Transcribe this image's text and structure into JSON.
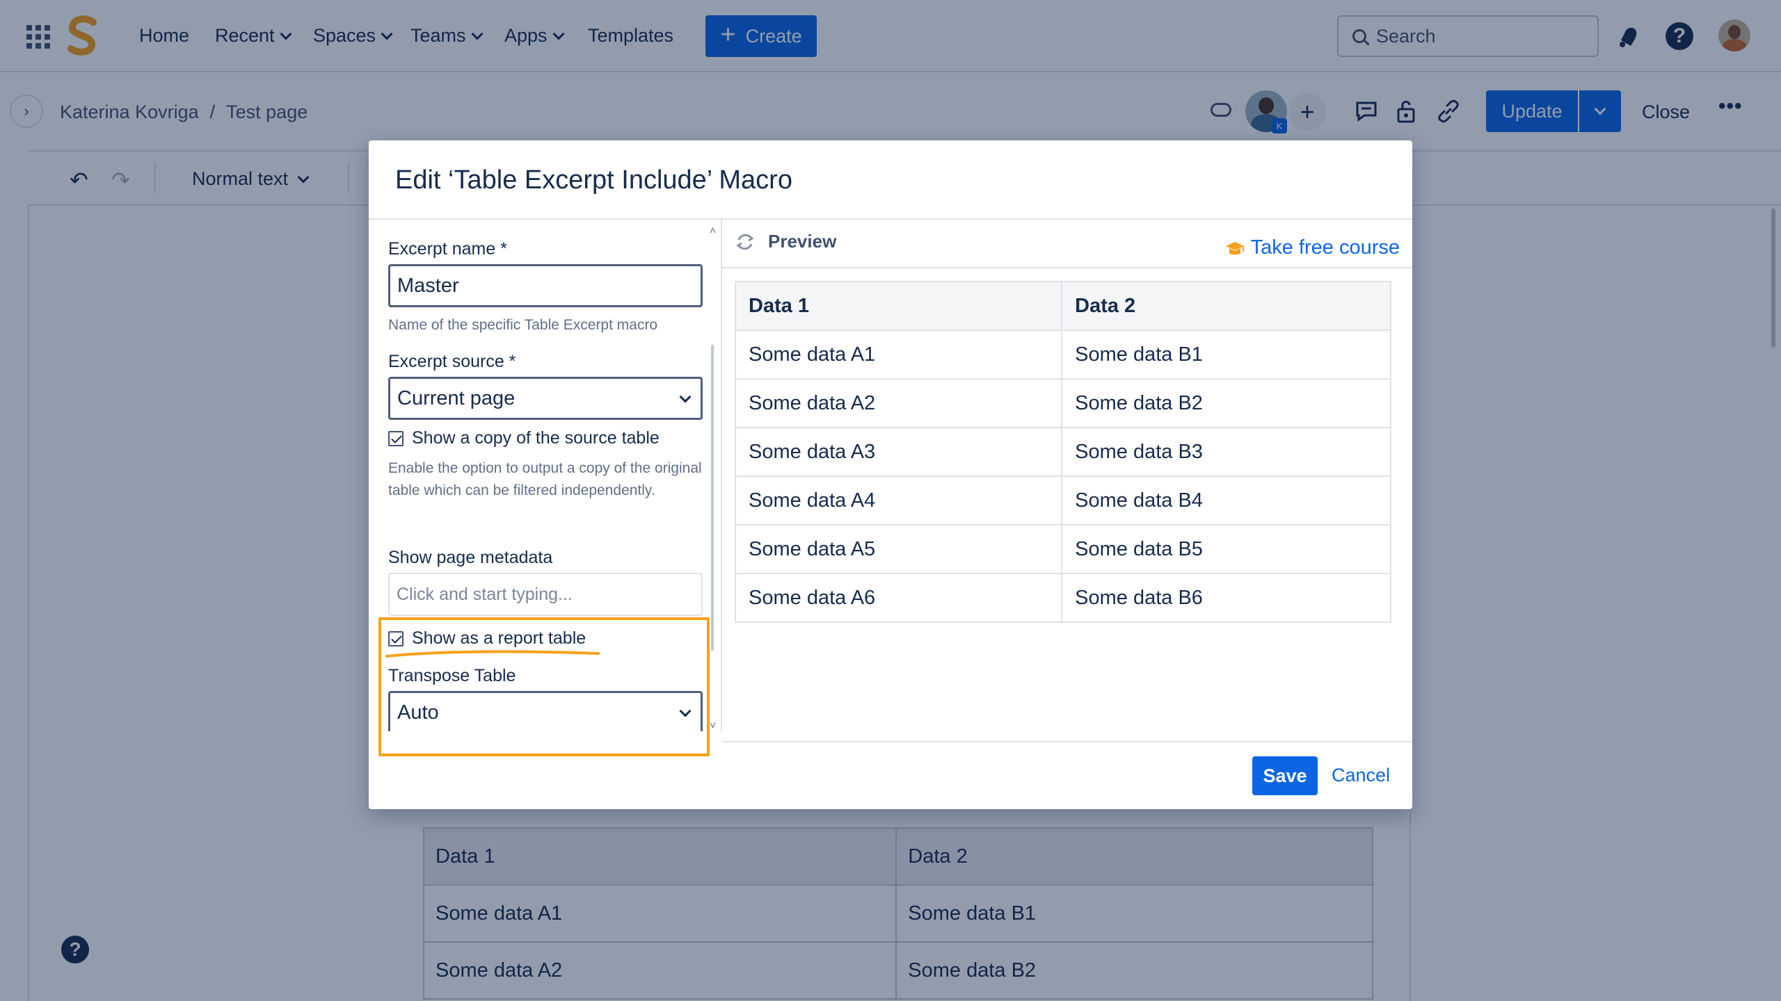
{
  "topnav": {
    "items": [
      {
        "label": "Home",
        "has_dropdown": false
      },
      {
        "label": "Recent",
        "has_dropdown": true
      },
      {
        "label": "Spaces",
        "has_dropdown": true
      },
      {
        "label": "Teams",
        "has_dropdown": true
      },
      {
        "label": "Apps",
        "has_dropdown": true
      },
      {
        "label": "Templates",
        "has_dropdown": false
      }
    ],
    "create_label": "Create",
    "search_placeholder": "Search"
  },
  "breadcrumb": {
    "space": "Katerina Kovriga",
    "separator": "/",
    "page": "Test page"
  },
  "collaborator_badge": "K",
  "subbar": {
    "update_label": "Update",
    "close_label": "Close"
  },
  "toolbar": {
    "text_style": "Normal text"
  },
  "background_table": {
    "headers": [
      "Data 1",
      "Data 2"
    ],
    "rows": [
      [
        "Some data A1",
        "Some data B1"
      ],
      [
        "Some data A2",
        "Some data B2"
      ]
    ]
  },
  "modal": {
    "title": "Edit ‘Table Excerpt Include’ Macro",
    "form": {
      "excerpt_name_label": "Excerpt name *",
      "excerpt_name_value": "Master",
      "excerpt_name_help": "Name of the specific Table Excerpt macro",
      "excerpt_source_label": "Excerpt source *",
      "excerpt_source_value": "Current page",
      "show_copy_label": "Show a copy of the source table",
      "show_copy_checked": true,
      "show_copy_help": "Enable the option to output a copy of the original table which can be filtered independently.",
      "metadata_label": "Show page metadata",
      "metadata_placeholder": "Click and start typing...",
      "report_table_label": "Show as a report table",
      "report_table_checked": true,
      "transpose_label": "Transpose Table",
      "transpose_value": "Auto"
    },
    "preview": {
      "title": "Preview",
      "course_link": "Take free course",
      "headers": [
        "Data 1",
        "Data 2"
      ],
      "rows": [
        [
          "Some data A1",
          "Some data B1"
        ],
        [
          "Some data A2",
          "Some data B2"
        ],
        [
          "Some data A3",
          "Some data B3"
        ],
        [
          "Some data A4",
          "Some data B4"
        ],
        [
          "Some data A5",
          "Some data B5"
        ],
        [
          "Some data A6",
          "Some data B6"
        ]
      ]
    },
    "save_label": "Save",
    "cancel_label": "Cancel"
  },
  "colors": {
    "primary": "#0c66e4",
    "highlight": "#f6a11c",
    "text": "#172b4d",
    "logo": "#f6a11c"
  }
}
